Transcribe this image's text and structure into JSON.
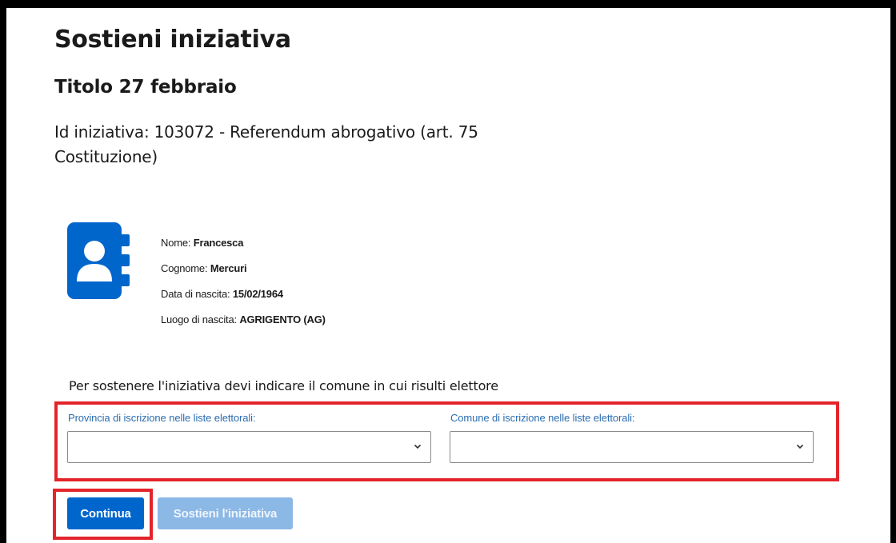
{
  "page": {
    "title": "Sostieni iniziativa",
    "subtitle": "Titolo 27 febbraio",
    "initiative_line": "Id iniziativa: 103072 - Referendum abrogativo (art. 75 Costituzione)"
  },
  "person": {
    "icon": "contact-book-icon",
    "rows": [
      {
        "label": "Nome:",
        "value": "Francesca"
      },
      {
        "label": "Cognome:",
        "value": "Mercuri"
      },
      {
        "label": "Data di nascita:",
        "value": "15/02/1964"
      },
      {
        "label": "Luogo di nascita:",
        "value": "AGRIGENTO (AG)"
      }
    ]
  },
  "form": {
    "instruction": "Per sostenere l'iniziativa devi indicare il comune in cui risulti elettore",
    "provincia_label": "Provincia di iscrizione nelle liste elettorali:",
    "provincia_value": "",
    "comune_label": "Comune di iscrizione nelle liste elettorali:",
    "comune_value": ""
  },
  "actions": {
    "continue_label": "Continua",
    "support_label": "Sostieni l'iniziativa"
  },
  "colors": {
    "accent": "#0066cc",
    "accent_disabled": "#8cb8e6",
    "label_blue": "#2b6db0",
    "highlight": "#e3242b"
  }
}
